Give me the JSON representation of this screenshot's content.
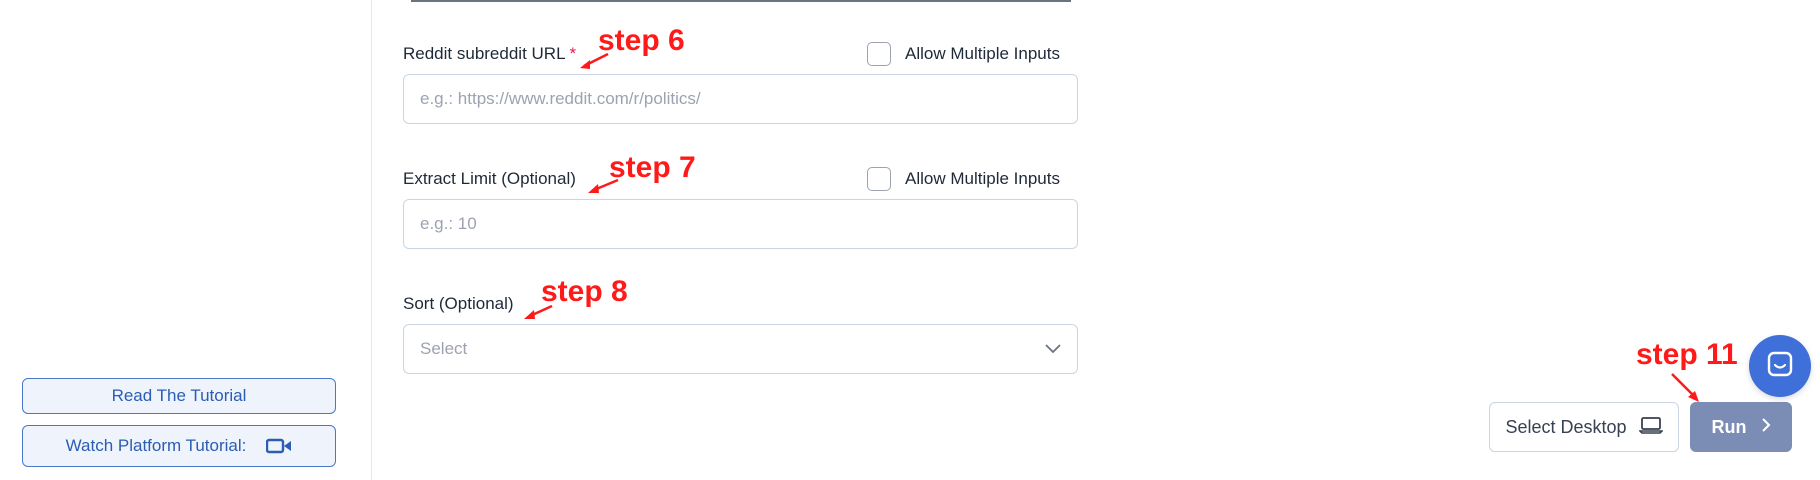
{
  "sidebar": {
    "read_tutorial": "Read The Tutorial",
    "watch_tutorial": "Watch Platform Tutorial:",
    "video_icon": "video-camera-icon"
  },
  "form": {
    "subreddit": {
      "label": "Reddit subreddit URL",
      "required": "*",
      "placeholder": "e.g.: https://www.reddit.com/r/politics/",
      "value": "",
      "multi_label": "Allow Multiple Inputs"
    },
    "extract_limit": {
      "label": "Extract Limit (Optional)",
      "placeholder": "e.g.: 10",
      "value": "",
      "multi_label": "Allow Multiple Inputs"
    },
    "sort": {
      "label": "Sort (Optional)",
      "selected": "Select"
    }
  },
  "annotations": {
    "step6": "step 6",
    "step7": "step 7",
    "step8": "step 8",
    "step11": "step 11",
    "color": "#ff1a1a"
  },
  "footer": {
    "select_desktop": "Select Desktop",
    "laptop_icon": "laptop-icon",
    "run": "Run"
  },
  "colors": {
    "accent": "#2b5db3",
    "run_button": "#7c8db5",
    "chat_bubble": "#3f6fd8"
  }
}
